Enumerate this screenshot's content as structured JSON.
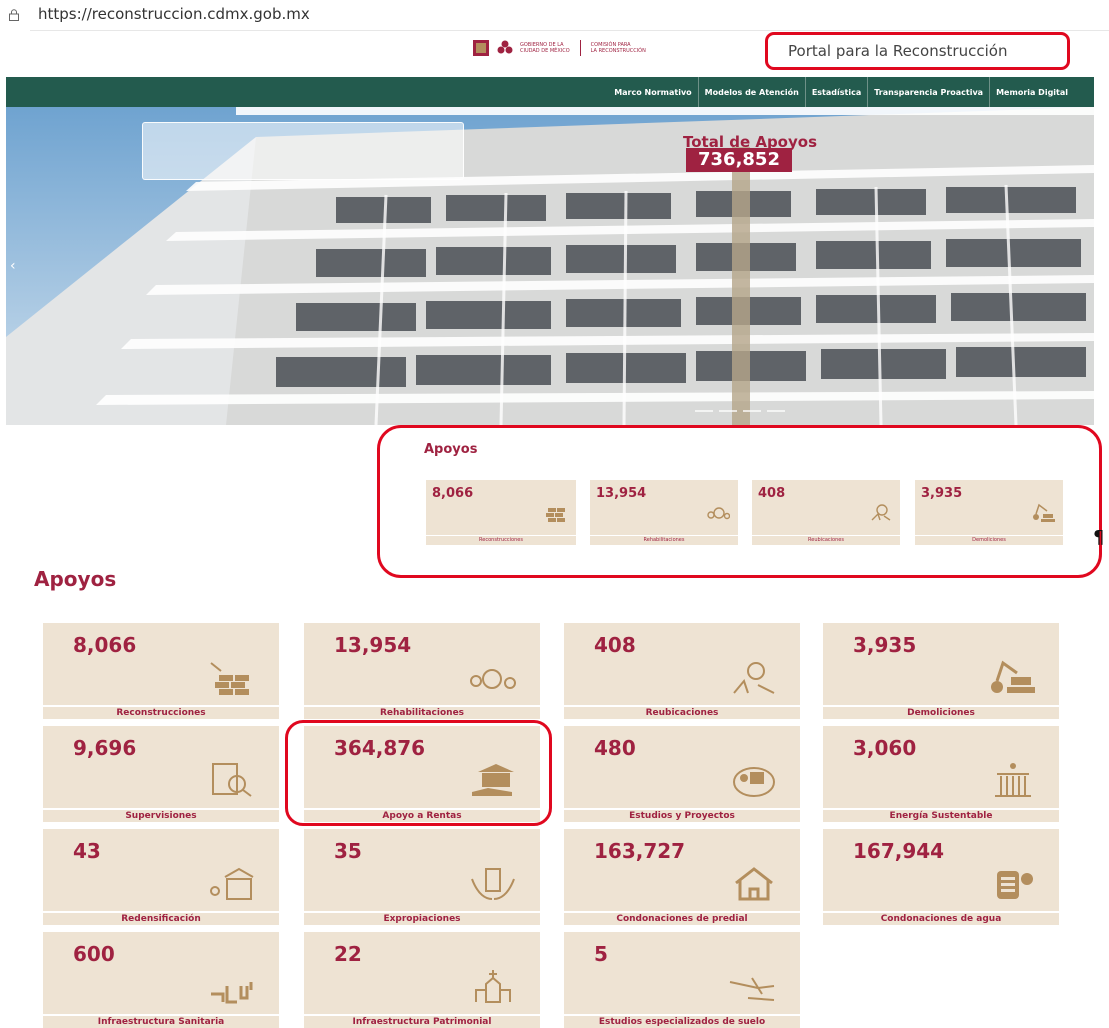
{
  "browser": {
    "url": "https://reconstruccion.cdmx.gob.mx"
  },
  "header": {
    "logo_lines_left": [
      "GOBIERNO DE LA",
      "CIUDAD DE MÉXICO"
    ],
    "logo_lines_right": [
      "COMISIÓN PARA",
      "LA RECONSTRUCCIÓN"
    ],
    "portal_title": "Portal para la Reconstrucción"
  },
  "nav": {
    "items": [
      "Marco Normativo",
      "Modelos de Atención",
      "Estadística",
      "Transparencia Proactiva",
      "Memoria Digital"
    ]
  },
  "hero": {
    "total_label": "Total de Apoyos",
    "total_value": "736,852",
    "prev_arrow": "‹"
  },
  "small_apoyos": {
    "title": "Apoyos",
    "cards": [
      {
        "value": "8,066",
        "label": "Reconstrucciones",
        "icon": "bricks-icon"
      },
      {
        "value": "13,954",
        "label": "Rehabilitaciones",
        "icon": "gears-icon"
      },
      {
        "value": "408",
        "label": "Reubicaciones",
        "icon": "relocation-icon"
      },
      {
        "value": "3,935",
        "label": "Demoliciones",
        "icon": "crane-icon"
      }
    ],
    "pilcrow": "¶"
  },
  "apoyos": {
    "title": "Apoyos",
    "cards": [
      {
        "value": "8,066",
        "label": "Reconstrucciones",
        "icon": "bricks-icon"
      },
      {
        "value": "13,954",
        "label": "Rehabilitaciones",
        "icon": "gears-icon"
      },
      {
        "value": "408",
        "label": "Reubicaciones",
        "icon": "relocation-icon"
      },
      {
        "value": "3,935",
        "label": "Demoliciones",
        "icon": "crane-icon"
      },
      {
        "value": "9,696",
        "label": "Supervisiones",
        "icon": "inspection-icon"
      },
      {
        "value": "364,876",
        "label": "Apoyo a Rentas",
        "icon": "rent-support-icon"
      },
      {
        "value": "480",
        "label": "Estudios y Proyectos",
        "icon": "study-icon"
      },
      {
        "value": "3,060",
        "label": "Energía Sustentable",
        "icon": "energy-icon"
      },
      {
        "value": "43",
        "label": "Redensificación",
        "icon": "building-icon"
      },
      {
        "value": "35",
        "label": "Expropiaciones",
        "icon": "hands-building-icon"
      },
      {
        "value": "163,727",
        "label": "Condonaciones de predial",
        "icon": "house-icon"
      },
      {
        "value": "167,944",
        "label": "Condonaciones de agua",
        "icon": "water-meter-icon"
      },
      {
        "value": "600",
        "label": "Infraestructura Sanitaria",
        "icon": "pipes-icon"
      },
      {
        "value": "22",
        "label": "Infraestructura Patrimonial",
        "icon": "church-icon"
      },
      {
        "value": "5",
        "label": "Estudios especializados de suelo",
        "icon": "drill-icon"
      }
    ]
  },
  "colors": {
    "brand": "#9f2241",
    "nav": "#235b4e",
    "card": "#eee3d3",
    "highlight": "#e0081f",
    "icon": "#b38e5d"
  }
}
